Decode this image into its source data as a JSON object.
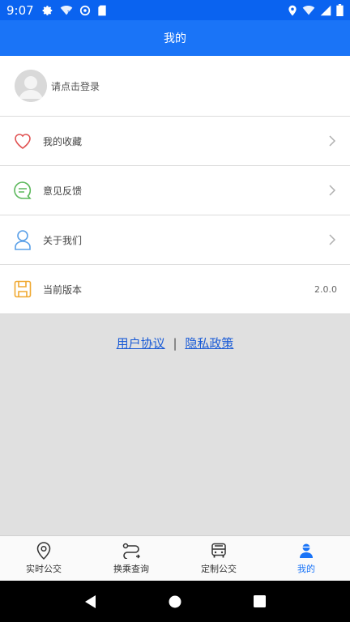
{
  "status_bar": {
    "time": "9:07"
  },
  "header": {
    "title": "我的"
  },
  "profile": {
    "login_prompt": "请点击登录"
  },
  "menu": [
    {
      "label": "我的收藏",
      "icon": "heart-icon"
    },
    {
      "label": "意见反馈",
      "icon": "chat-bubble-icon"
    },
    {
      "label": "关于我们",
      "icon": "person-icon"
    },
    {
      "label": "当前版本",
      "icon": "floppy-disk-icon",
      "value": "2.0.0"
    }
  ],
  "links": {
    "user_agreement": "用户协议",
    "separator": "|",
    "privacy_policy": "隐私政策"
  },
  "tabs": [
    {
      "label": "实时公交",
      "icon": "location-pin-icon"
    },
    {
      "label": "换乘查询",
      "icon": "route-icon"
    },
    {
      "label": "定制公交",
      "icon": "bus-icon"
    },
    {
      "label": "我的",
      "icon": "user-icon",
      "active": true
    }
  ],
  "colors": {
    "status_bar": "#0a63f0",
    "header": "#1a74f7",
    "link": "#1a5bd6",
    "active_tab": "#1a74f7"
  }
}
